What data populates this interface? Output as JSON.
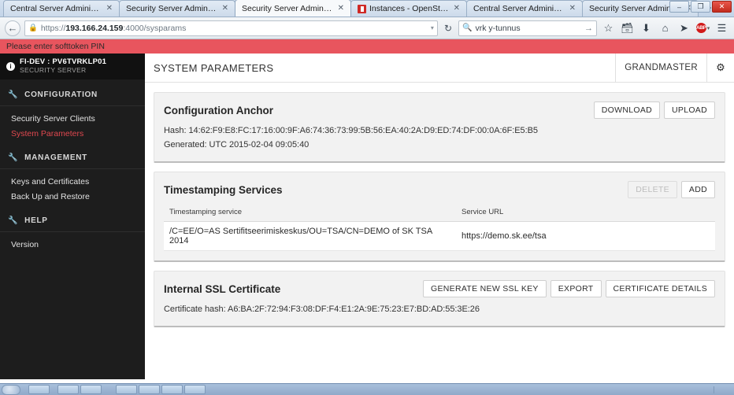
{
  "browser": {
    "tabs": [
      {
        "label": "Central Server Administration",
        "active": false,
        "favicon": "none"
      },
      {
        "label": "Security Server Administration",
        "active": false,
        "favicon": "none"
      },
      {
        "label": "Security Server Administration",
        "active": true,
        "favicon": "none"
      },
      {
        "label": "Instances - OpenStack D...",
        "active": false,
        "favicon": "openstack-icon"
      },
      {
        "label": "Central Server Administration",
        "active": false,
        "favicon": "none"
      },
      {
        "label": "Security Server Administration",
        "active": false,
        "favicon": "none"
      }
    ],
    "tab_close_glyph": "✕",
    "new_tab_label": "+",
    "window_controls": {
      "minimize": "–",
      "restore": "❐",
      "close": "✕"
    },
    "back_glyph": "←",
    "lock_glyph": "🔒",
    "url": {
      "scheme": "https://",
      "host": "193.166.24.159",
      "path": ":4000/sysparams",
      "full": "https://193.166.24.159:4000/sysparams"
    },
    "url_dropdown_glyph": "▾",
    "reload_glyph": "↻",
    "search": {
      "value": "vrk y-tunnus",
      "placeholder": "Search",
      "icon": "search-icon",
      "go_glyph": "→"
    },
    "toolbar_icons": [
      {
        "name": "bookmark-star-icon",
        "glyph": "☆"
      },
      {
        "name": "reading-list-icon",
        "glyph": "὜9"
      },
      {
        "name": "downloads-icon",
        "glyph": "⬇"
      },
      {
        "name": "home-icon",
        "glyph": "⌂"
      },
      {
        "name": "send-tab-icon",
        "glyph": "➤"
      },
      {
        "name": "adblock-icon",
        "glyph": "ABP"
      },
      {
        "name": "menu-hamburger-icon",
        "glyph": "☰"
      }
    ]
  },
  "notification": {
    "message": "Please enter softtoken PIN",
    "color": "#e8555e"
  },
  "sidebar": {
    "brand": {
      "icon": "info-icon",
      "icon_glyph": "i",
      "name": "FI-DEV : PV6TVRKLP01",
      "subtitle": "SECURITY SERVER"
    },
    "sections": [
      {
        "label": "CONFIGURATION",
        "icon": "wrench-icon",
        "items": [
          {
            "label": "Security Server Clients",
            "active": false
          },
          {
            "label": "System Parameters",
            "active": true
          }
        ]
      },
      {
        "label": "MANAGEMENT",
        "icon": "wrench-icon",
        "items": [
          {
            "label": "Keys and Certificates",
            "active": false
          },
          {
            "label": "Back Up and Restore",
            "active": false
          }
        ]
      },
      {
        "label": "HELP",
        "icon": "wrench-icon",
        "items": [
          {
            "label": "Version",
            "active": false
          }
        ]
      }
    ],
    "active_color": "#e0484f"
  },
  "topbar": {
    "title": "SYSTEM PARAMETERS",
    "user": "GRANDMASTER",
    "settings_icon": "gear-icon",
    "settings_glyph": "⚙"
  },
  "cards": {
    "configuration_anchor": {
      "title": "Configuration Anchor",
      "buttons": [
        {
          "label": "DOWNLOAD",
          "disabled": false
        },
        {
          "label": "UPLOAD",
          "disabled": false
        }
      ],
      "hash_line": "Hash: 14:62:F9:E8:FC:17:16:00:9F:A6:74:36:73:99:5B:56:EA:40:2A:D9:ED:74:DF:00:0A:6F:E5:B5",
      "generated_line": "Generated: UTC 2015-02-04 09:05:40"
    },
    "timestamping_services": {
      "title": "Timestamping Services",
      "buttons": [
        {
          "label": "DELETE",
          "disabled": true
        },
        {
          "label": "ADD",
          "disabled": false
        }
      ],
      "columns": [
        "Timestamping service",
        "Service URL"
      ],
      "rows": [
        {
          "service": "/C=EE/O=AS Sertifitseerimiskeskus/OU=TSA/CN=DEMO of SK TSA 2014",
          "url": "https://demo.sk.ee/tsa"
        }
      ]
    },
    "internal_ssl_certificate": {
      "title": "Internal SSL Certificate",
      "buttons": [
        {
          "label": "GENERATE NEW SSL KEY",
          "disabled": false
        },
        {
          "label": "EXPORT",
          "disabled": false
        },
        {
          "label": "CERTIFICATE DETAILS",
          "disabled": false
        }
      ],
      "hash_line": "Certificate hash: A6:BA:2F:72:94:F3:08:DF:F4:E1:2A:9E:75:23:E7:BD:AD:55:3E:26"
    }
  }
}
